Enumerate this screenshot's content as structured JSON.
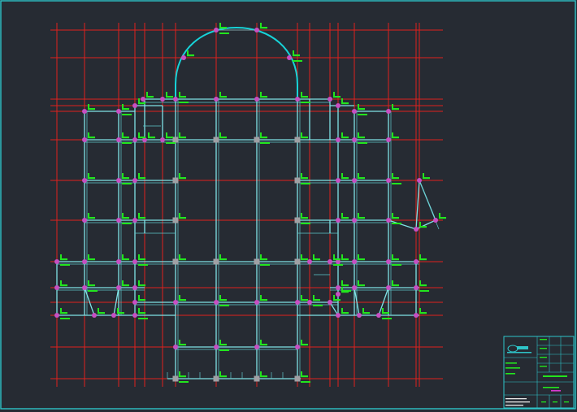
{
  "drawing": {
    "colors": {
      "background": "#262b33",
      "grid": "#e0201c",
      "beam": "#7fe3e6",
      "arch": "#17d3d8",
      "column": "#c74fc2",
      "label": "#22e51e",
      "frame": "#2ec4c8"
    },
    "icons": [
      "company-logo-icon"
    ]
  }
}
